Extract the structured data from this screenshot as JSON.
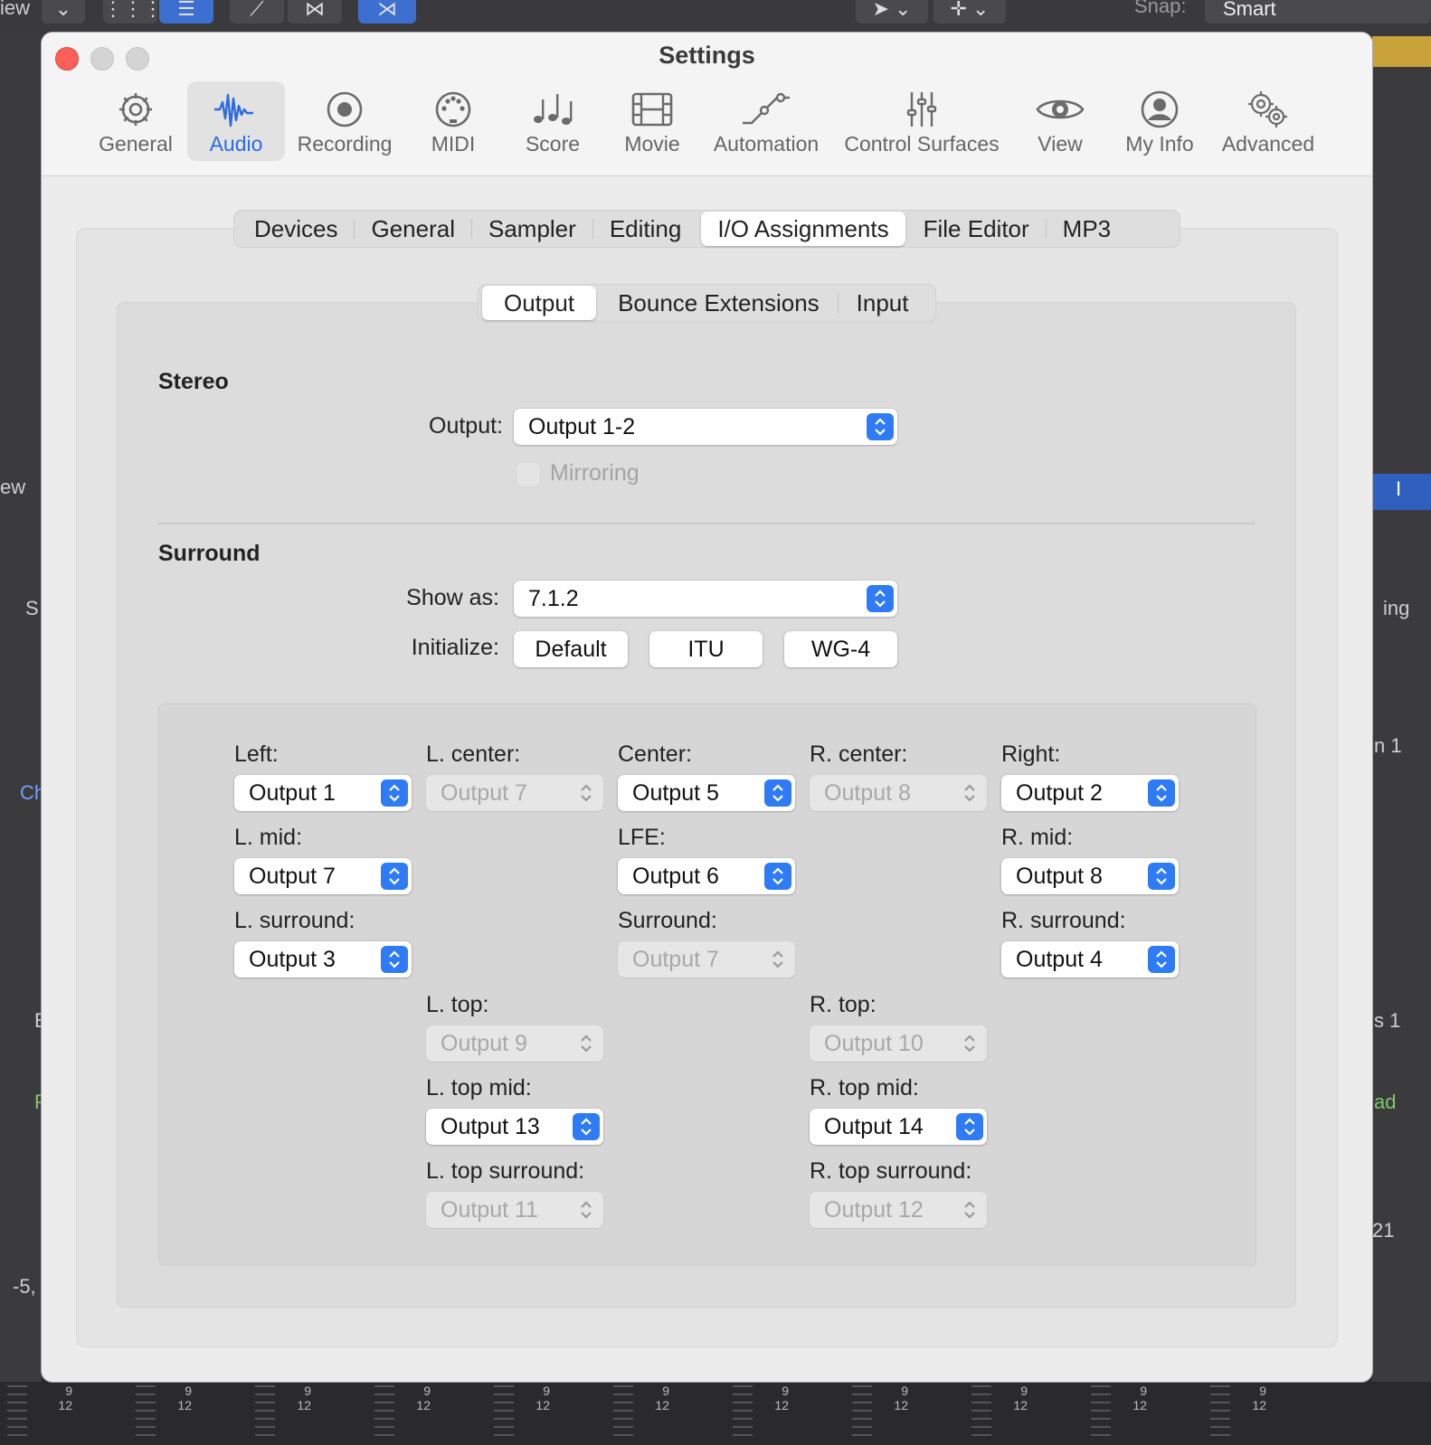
{
  "background": {
    "toolbar_view": "iew",
    "snap_label": "Snap:",
    "snap_value": "Smart",
    "left_view": "ew",
    "left_s": "S",
    "left_ch": "Ch",
    "left_e": "E",
    "left_p": "P",
    "left_value": "-5,",
    "right_ing": "ing",
    "right_n1": "n 1",
    "right_s1": "s 1",
    "right_ad": "ad",
    "right_21": "21",
    "right_i": "I",
    "meter_top": "9",
    "meter_bottom": "12"
  },
  "window": {
    "title": "Settings"
  },
  "toolbar": {
    "items": [
      {
        "label": "General",
        "icon": "gear-icon"
      },
      {
        "label": "Audio",
        "icon": "waveform-icon",
        "active": true
      },
      {
        "label": "Recording",
        "icon": "record-icon"
      },
      {
        "label": "MIDI",
        "icon": "midi-icon"
      },
      {
        "label": "Score",
        "icon": "notes-icon"
      },
      {
        "label": "Movie",
        "icon": "film-icon"
      },
      {
        "label": "Automation",
        "icon": "automation-icon"
      },
      {
        "label": "Control Surfaces",
        "icon": "sliders-icon"
      },
      {
        "label": "View",
        "icon": "eye-icon"
      },
      {
        "label": "My Info",
        "icon": "person-icon"
      },
      {
        "label": "Advanced",
        "icon": "gears-icon"
      }
    ]
  },
  "tabs": [
    "Devices",
    "General",
    "Sampler",
    "Editing",
    "I/O Assignments",
    "File Editor",
    "MP3"
  ],
  "subtabs": [
    "Output",
    "Bounce Extensions",
    "Input"
  ],
  "stereo": {
    "title": "Stereo",
    "output_label": "Output:",
    "output_value": "Output 1-2",
    "mirroring_label": "Mirroring"
  },
  "surround": {
    "title": "Surround",
    "show_as_label": "Show as:",
    "show_as_value": "7.1.2",
    "initialize_label": "Initialize:",
    "buttons": [
      "Default",
      "ITU",
      "WG-4"
    ],
    "left": {
      "label": "Left:",
      "value": "Output 1"
    },
    "l_center": {
      "label": "L. center:",
      "value": "Output 7"
    },
    "center": {
      "label": "Center:",
      "value": "Output 5"
    },
    "r_center": {
      "label": "R. center:",
      "value": "Output 8"
    },
    "right": {
      "label": "Right:",
      "value": "Output 2"
    },
    "l_mid": {
      "label": "L. mid:",
      "value": "Output 7"
    },
    "lfe": {
      "label": "LFE:",
      "value": "Output 6"
    },
    "r_mid": {
      "label": "R. mid:",
      "value": "Output 8"
    },
    "l_surround": {
      "label": "L. surround:",
      "value": "Output 3"
    },
    "surround": {
      "label": "Surround:",
      "value": "Output 7"
    },
    "r_surround": {
      "label": "R. surround:",
      "value": "Output 4"
    },
    "l_top": {
      "label": "L. top:",
      "value": "Output 9"
    },
    "r_top": {
      "label": "R. top:",
      "value": "Output 10"
    },
    "l_top_mid": {
      "label": "L. top mid:",
      "value": "Output 13"
    },
    "r_top_mid": {
      "label": "R. top mid:",
      "value": "Output 14"
    },
    "l_top_surround": {
      "label": "L. top surround:",
      "value": "Output 11"
    },
    "r_top_surround": {
      "label": "R. top surround:",
      "value": "Output 12"
    }
  }
}
